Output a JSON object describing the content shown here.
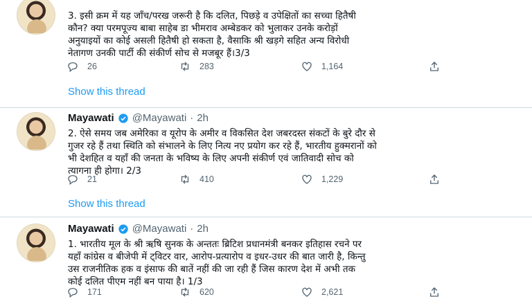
{
  "tweets": [
    {
      "name": "",
      "handle": "",
      "time": "",
      "text": "3. इसी क्रम में यह जाँच/परख जरूरी है कि दलित, पिछड़े व उपेक्षितों का सच्चा हितैषी\nकौन? क्या परमपूज्य बाबा साहेब डा भीमराव अम्बेडकर को भुलाकर उनके करोड़ों\nअनुयाइयों का कोई असली हितैषी हो सकता है, वैसाकि श्री खड़गे सहित अन्य विरोधी\nनेतागण उनकी पार्टी की संकीर्ण सोच से मजबूर हैं।3/3",
      "replies": "26",
      "retweets": "283",
      "likes": "1,164",
      "show_thread": "Show this thread",
      "icons": {
        "reply": "reply-icon",
        "retweet": "retweet-icon",
        "like": "heart-icon",
        "share": "share-icon"
      }
    },
    {
      "name": "Mayawati",
      "handle": "@Mayawati",
      "dot": "·",
      "time": "2h",
      "text": "2. ऐसे समय जब अमेरिका व यूरोप के अमीर व विकसित देश जबरदस्त संकटों के बुरे दौर से\nगुजर रहे हैं तथा स्थिति को संभालने के लिए नित्य नए प्रयोग कर रहे हैं, भारतीय हुक्मरानों को\nभी देशहित व यहाँ की जनता के भविष्य के लिए अपनी संकीर्ण एवं जातिवादी सोच को\nत्यागना ही होगा। 2/3",
      "replies": "21",
      "retweets": "410",
      "likes": "1,229",
      "show_thread": "Show this thread"
    },
    {
      "name": "Mayawati",
      "handle": "@Mayawati",
      "dot": "·",
      "time": "2h",
      "text": "1. भारतीय मूल के श्री ऋषि सुनक के अन्ततः ब्रिटिश प्रधानमंत्री बनकर इतिहास रचने पर\nयहाँ कांग्रेस व बीजेपी में ट्विटर वार, आरोप-प्रत्यारोप व इधर-उधर की बात जारी है, किन्तु\nउस राजनीतिक हक व इंसाफ की बातें नहीं की जा रही हैं जिस कारण देश में अभी तक\nकोई दलित पीएम नहीं बन पाया है। 1/3",
      "replies": "171",
      "retweets": "620",
      "likes": "2,621"
    }
  ],
  "colors": {
    "accent": "#1d9bf0",
    "muted": "#536471",
    "text": "#0f1419",
    "divider": "#cfd9de"
  }
}
